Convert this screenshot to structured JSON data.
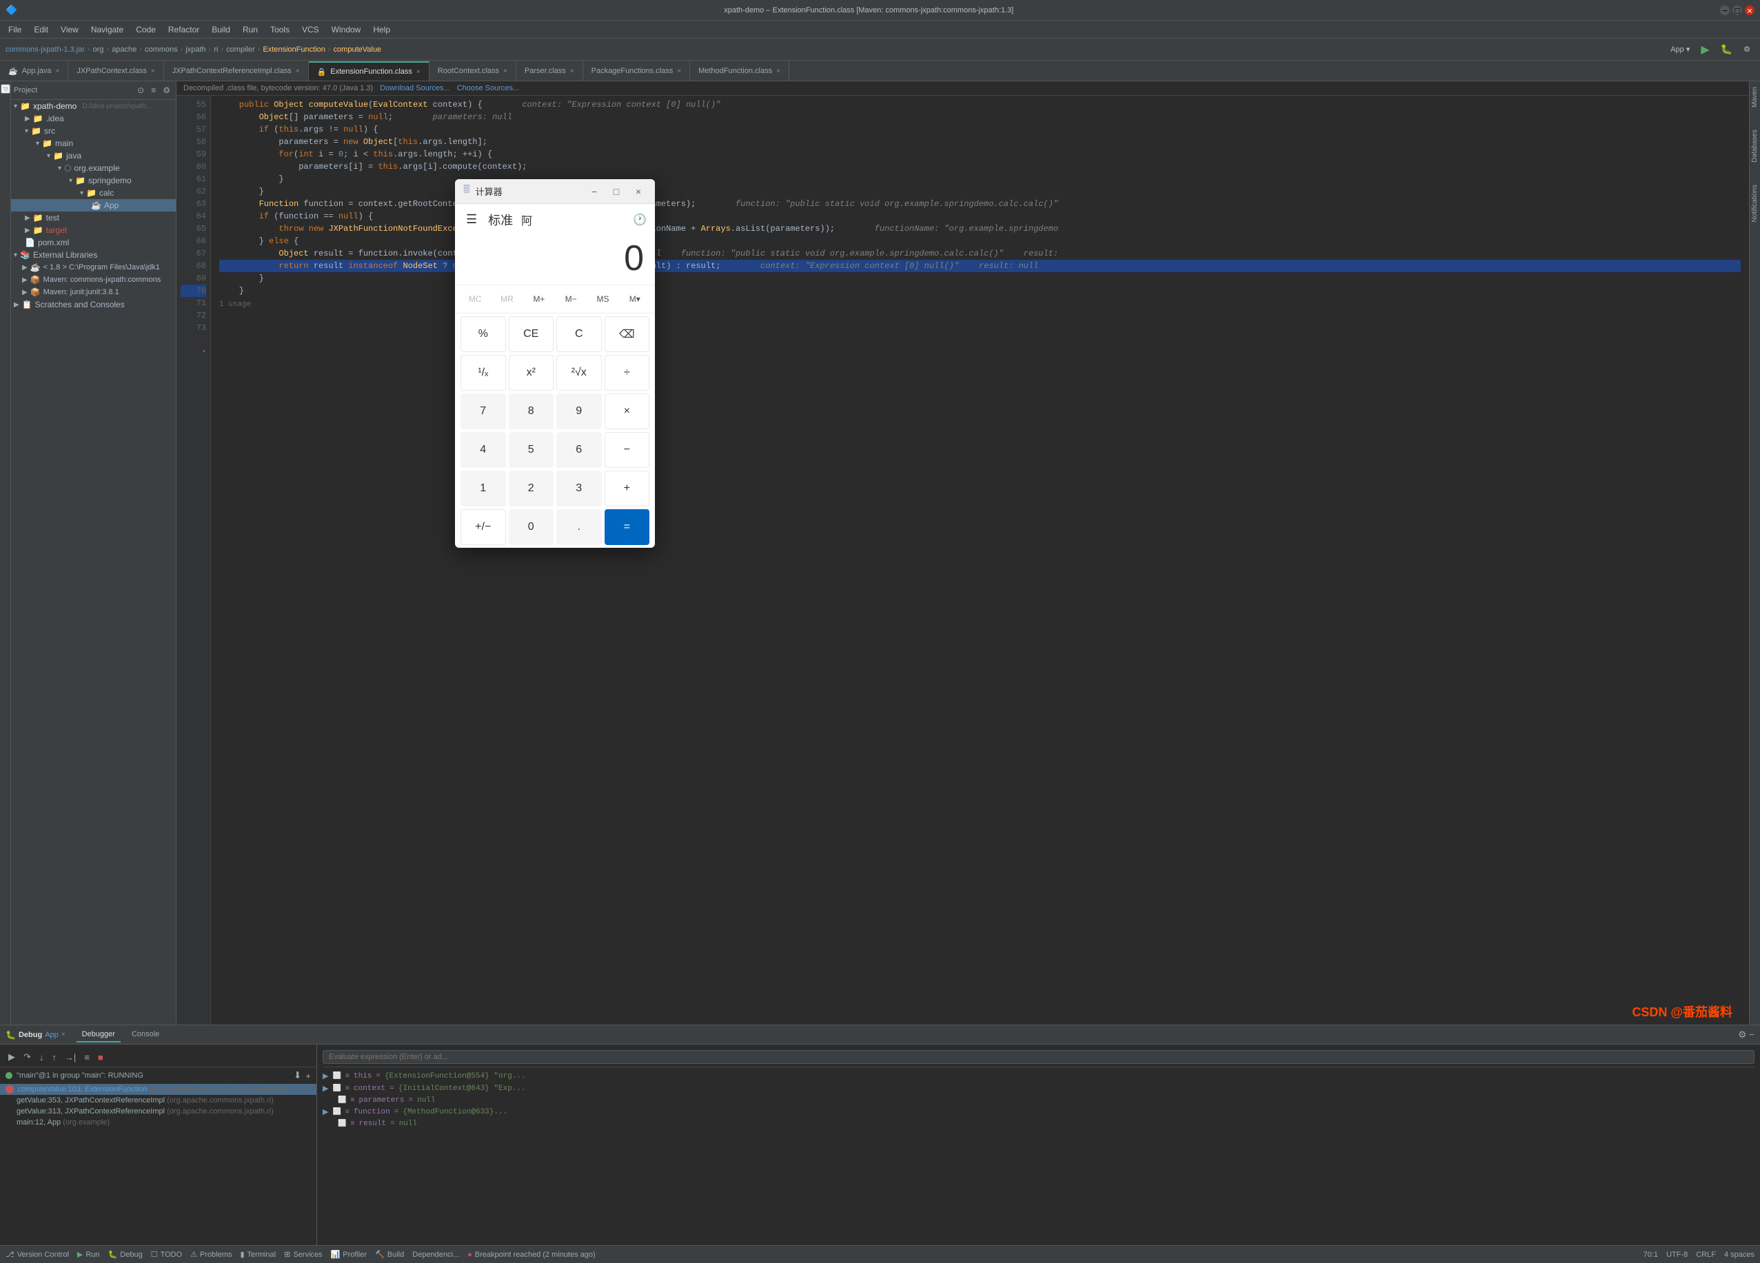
{
  "window": {
    "title": "xpath-demo – ExtensionFunction.class [Maven: commons-jxpath:commons-jxpath:1.3]",
    "jar_label": "commons-jxpath-1.3.jar",
    "breadcrumbs": [
      "org",
      "apache",
      "commons",
      "jxpath",
      "ri",
      "compiler",
      "ExtensionFunction",
      "computeValue"
    ]
  },
  "menu": {
    "items": [
      "File",
      "Edit",
      "View",
      "Navigate",
      "Code",
      "Refactor",
      "Build",
      "Run",
      "Tools",
      "VCS",
      "Window",
      "Help"
    ]
  },
  "toolbar": {
    "app_dropdown": "App",
    "run_config": "App"
  },
  "tabs": [
    {
      "label": "App.java",
      "active": false
    },
    {
      "label": "JXPathContext.class",
      "active": false
    },
    {
      "label": "JXPathContextReferenceImpl.class",
      "active": false
    },
    {
      "label": "ExtensionFunction.class",
      "active": true
    },
    {
      "label": "RootContext.class",
      "active": false
    },
    {
      "label": "Parser.class",
      "active": false
    },
    {
      "label": "PackageFunctions.class",
      "active": false
    },
    {
      "label": "MethodFunction.class",
      "active": false
    }
  ],
  "editor": {
    "file_info": "Decompiled .class file, bytecode version: 47.0 (Java 1.3)",
    "download_sources": "Download Sources...",
    "choose_sources": "Choose Sources...",
    "lines": [
      {
        "num": 55,
        "code": "    public Object computeValue(EvalContext context) {",
        "hint": "context: \"Expression context [0] null()\""
      },
      {
        "num": 56,
        "code": "        Object[] parameters = null;",
        "hint": "parameters: null"
      },
      {
        "num": 57,
        "code": "        if (this.args != null) {",
        "hint": ""
      },
      {
        "num": 58,
        "code": "            parameters = new Object[this.args.length];",
        "hint": ""
      },
      {
        "num": 59,
        "code": "",
        "hint": ""
      },
      {
        "num": 60,
        "code": "            for(int i = 0; i < this.args.length; ++i) {",
        "hint": ""
      },
      {
        "num": 61,
        "code": "                parameters[i] = this.args[i].compute(context);",
        "hint": ""
      },
      {
        "num": 62,
        "code": "            }",
        "hint": ""
      },
      {
        "num": 63,
        "code": "        }",
        "hint": ""
      },
      {
        "num": 64,
        "code": "",
        "hint": ""
      },
      {
        "num": 65,
        "code": "        Function function = context.getRootContext().getFunction(this.functionName, parameters);",
        "hint": "function: \"public static void org.example.springdemo.calc.calc()\""
      },
      {
        "num": 66,
        "code": "        if (function == null) {",
        "hint": ""
      },
      {
        "num": 67,
        "code": "            throw new JXPathFunctionNotFoundException(\"No such function: \" + this.functionName + Arrays.asList(parameters));",
        "hint": "functionName: \"org.example.springdemo\""
      },
      {
        "num": 68,
        "code": "        } else {",
        "hint": ""
      },
      {
        "num": 69,
        "code": "            Object result = function.invoke(context, parameters);",
        "hint": "parameters: null    function: \"public static void org.example.springdemo.calc.calc()\"    result:"
      },
      {
        "num": 70,
        "code": "            return result instanceof NodeSet ? new NodeSetContext(context, (NodeSet)result) : result;",
        "hint": "context: \"Expression context [0] null()\"    result: null",
        "highlighted": true
      },
      {
        "num": 71,
        "code": "        }",
        "hint": ""
      },
      {
        "num": 72,
        "code": "    }",
        "hint": ""
      },
      {
        "num": 73,
        "code": "",
        "hint": ""
      }
    ],
    "usage_hint": "1 usage"
  },
  "sidebar": {
    "project_label": "Project",
    "root": "xpath-demo",
    "root_path": "D:/idea-project/xpath-demo",
    "items": [
      {
        "label": ".idea",
        "type": "folder",
        "indent": 1
      },
      {
        "label": "src",
        "type": "folder",
        "indent": 1
      },
      {
        "label": "main",
        "type": "folder",
        "indent": 2
      },
      {
        "label": "java",
        "type": "folder",
        "indent": 3
      },
      {
        "label": "org.example",
        "type": "package",
        "indent": 4
      },
      {
        "label": "springdemo",
        "type": "folder",
        "indent": 5
      },
      {
        "label": "calc",
        "type": "folder",
        "indent": 6
      },
      {
        "label": "App",
        "type": "java",
        "indent": 7,
        "selected": true
      },
      {
        "label": "test",
        "type": "folder",
        "indent": 1
      },
      {
        "label": "target",
        "type": "folder",
        "indent": 1
      },
      {
        "label": "pom.xml",
        "type": "xml",
        "indent": 1
      }
    ],
    "external_libs": [
      {
        "label": "External Libraries",
        "type": "folder"
      },
      {
        "label": "< 1.8 > C:\\Program Files\\Java\\jdk1",
        "type": "lib",
        "indent": 1
      },
      {
        "label": "Maven: commons-jxpath:commons",
        "type": "lib",
        "indent": 1
      },
      {
        "label": "Maven: junit:junit:3.8.1",
        "type": "lib",
        "indent": 1
      },
      {
        "label": "Scratches and Consoles",
        "type": "folder"
      }
    ]
  },
  "debug_panel": {
    "title": "Debug",
    "tab_name": "App",
    "sub_tabs": [
      "Debugger",
      "Console"
    ],
    "run_status": "\"main\"@1 in group \"main\": RUNNING",
    "frames": [
      {
        "label": "computeValue:103, ExtensionFunction",
        "detail": "(org.apache.commons.jxpath.ri.compiler)",
        "active": true
      },
      {
        "label": "getValue:353, JXPathContextReferenceImpl",
        "detail": "(org.apache.commons.jxpath.ri)",
        "active": false
      },
      {
        "label": "getValue:313, JXPathContextReferenceImpl",
        "detail": "(org.apache.commons.jxpath.ri)",
        "active": false
      },
      {
        "label": "main:12, App",
        "detail": "(org.example)",
        "active": false
      }
    ],
    "variables": [
      {
        "name": "this",
        "value": "{ExtensionFunction@554} \"org...",
        "arrow": true
      },
      {
        "name": "context",
        "value": "{InitialContext@643} \"Exp...",
        "arrow": true
      },
      {
        "name": "parameters",
        "value": "null",
        "arrow": false
      },
      {
        "name": "function",
        "value": "{MethodFunction@633}...",
        "arrow": true
      },
      {
        "name": "result",
        "value": "null",
        "arrow": false
      }
    ],
    "expression_hint": "Evaluate expression (Enter) or ad..."
  },
  "calculator": {
    "title": "计算器",
    "mode": "标准",
    "mode_icon": "标",
    "display": "0",
    "memory_buttons": [
      "MC",
      "MR",
      "M+",
      "M-",
      "MS",
      "M▾"
    ],
    "buttons_row1": [
      "%",
      "CE",
      "C",
      "⌫"
    ],
    "buttons_row2": [
      "1/x",
      "x²",
      "²√x",
      "÷"
    ],
    "buttons_row3": [
      "7",
      "8",
      "9",
      "×"
    ],
    "buttons_row4": [
      "4",
      "5",
      "6",
      "−"
    ],
    "buttons_row5": [
      "1",
      "2",
      "3",
      "+"
    ],
    "buttons_row6": [
      "+/-",
      "0",
      ".",
      "="
    ]
  },
  "status_bar": {
    "version_control": "Version Control",
    "run_label": "Run",
    "debug_label": "Debug",
    "todo_label": "TODO",
    "problems_label": "Problems",
    "terminal_label": "Terminal",
    "services_label": "Services",
    "profiler_label": "Profiler",
    "build_label": "Build",
    "breakpoint_msg": "Breakpoint reached (2 minutes ago)",
    "line_col": "70:1",
    "encoding": "UTF-8",
    "indent": "4 spaces",
    "crlf": "CRLF"
  },
  "watermark": "CSDN @番茄酱料"
}
